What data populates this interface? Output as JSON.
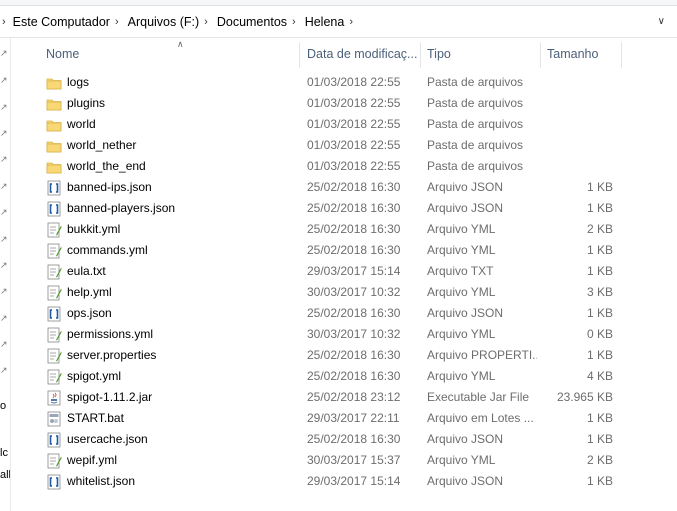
{
  "breadcrumb": {
    "items": [
      "Este Computador",
      "Arquivos (F:)",
      "Documentos",
      "Helena"
    ]
  },
  "columns": {
    "name": "Nome",
    "date": "Data de modificaç...",
    "type": "Tipo",
    "size": "Tamanho"
  },
  "nav_fragments": [
    "o",
    "lc",
    "all"
  ],
  "files": [
    {
      "name": "logs",
      "date": "01/03/2018 22:55",
      "type": "Pasta de arquivos",
      "size": "",
      "icon": "folder-icon"
    },
    {
      "name": "plugins",
      "date": "01/03/2018 22:55",
      "type": "Pasta de arquivos",
      "size": "",
      "icon": "folder-icon"
    },
    {
      "name": "world",
      "date": "01/03/2018 22:55",
      "type": "Pasta de arquivos",
      "size": "",
      "icon": "folder-icon"
    },
    {
      "name": "world_nether",
      "date": "01/03/2018 22:55",
      "type": "Pasta de arquivos",
      "size": "",
      "icon": "folder-icon"
    },
    {
      "name": "world_the_end",
      "date": "01/03/2018 22:55",
      "type": "Pasta de arquivos",
      "size": "",
      "icon": "folder-icon"
    },
    {
      "name": "banned-ips.json",
      "date": "25/02/2018 16:30",
      "type": "Arquivo JSON",
      "size": "1 KB",
      "icon": "json-file-icon"
    },
    {
      "name": "banned-players.json",
      "date": "25/02/2018 16:30",
      "type": "Arquivo JSON",
      "size": "1 KB",
      "icon": "json-file-icon"
    },
    {
      "name": "bukkit.yml",
      "date": "25/02/2018 16:30",
      "type": "Arquivo YML",
      "size": "2 KB",
      "icon": "yml-file-icon"
    },
    {
      "name": "commands.yml",
      "date": "25/02/2018 16:30",
      "type": "Arquivo YML",
      "size": "1 KB",
      "icon": "yml-file-icon"
    },
    {
      "name": "eula.txt",
      "date": "29/03/2017 15:14",
      "type": "Arquivo TXT",
      "size": "1 KB",
      "icon": "txt-file-icon"
    },
    {
      "name": "help.yml",
      "date": "30/03/2017 10:32",
      "type": "Arquivo YML",
      "size": "3 KB",
      "icon": "yml-file-icon"
    },
    {
      "name": "ops.json",
      "date": "25/02/2018 16:30",
      "type": "Arquivo JSON",
      "size": "1 KB",
      "icon": "json-file-icon"
    },
    {
      "name": "permissions.yml",
      "date": "30/03/2017 10:32",
      "type": "Arquivo YML",
      "size": "0 KB",
      "icon": "yml-file-icon"
    },
    {
      "name": "server.properties",
      "date": "25/02/2018 16:30",
      "type": "Arquivo PROPERTI...",
      "size": "1 KB",
      "icon": "properties-file-icon"
    },
    {
      "name": "spigot.yml",
      "date": "25/02/2018 16:30",
      "type": "Arquivo YML",
      "size": "4 KB",
      "icon": "yml-file-icon"
    },
    {
      "name": "spigot-1.11.2.jar",
      "date": "25/02/2018 23:12",
      "type": "Executable Jar File",
      "size": "23.965 KB",
      "icon": "jar-file-icon"
    },
    {
      "name": "START.bat",
      "date": "29/03/2017 22:11",
      "type": "Arquivo em Lotes ...",
      "size": "1 KB",
      "icon": "bat-file-icon"
    },
    {
      "name": "usercache.json",
      "date": "25/02/2018 16:30",
      "type": "Arquivo JSON",
      "size": "1 KB",
      "icon": "json-file-icon"
    },
    {
      "name": "wepif.yml",
      "date": "30/03/2017 15:37",
      "type": "Arquivo YML",
      "size": "2 KB",
      "icon": "yml-file-icon"
    },
    {
      "name": "whitelist.json",
      "date": "29/03/2017 15:14",
      "type": "Arquivo JSON",
      "size": "1 KB",
      "icon": "json-file-icon"
    }
  ],
  "colors": {
    "folder": "#f8d775",
    "json_bracket": "#1e5aa8",
    "yml_pencil": "#4d9a2f",
    "header_text": "#4c607a",
    "secondary_text": "#6d6d6d"
  }
}
